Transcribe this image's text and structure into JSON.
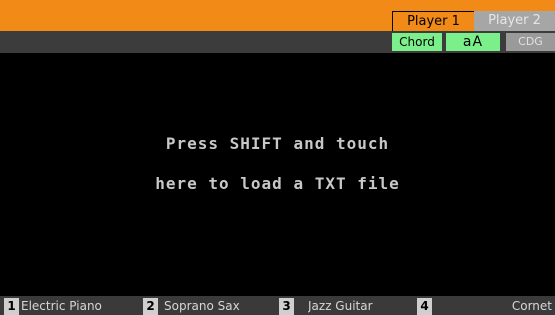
{
  "header": {
    "player_tabs": [
      {
        "label": "Player 1"
      },
      {
        "label": "Player 2"
      }
    ],
    "buttons": {
      "chord": "Chord",
      "text_size": "aA",
      "cdg": "CDG"
    }
  },
  "main": {
    "message_line1": "Press SHIFT and touch",
    "message_line2": "here to load a TXT file"
  },
  "footer": {
    "slots": [
      {
        "num": "1",
        "label": "Electric Piano"
      },
      {
        "num": "2",
        "label": "Soprano Sax"
      },
      {
        "num": "3",
        "label": "Jazz Guitar"
      },
      {
        "num": "4",
        "label": "Cornet"
      }
    ]
  },
  "colors": {
    "accent_orange": "#f28a17",
    "button_green": "#7bf08a",
    "background": "#000000"
  }
}
